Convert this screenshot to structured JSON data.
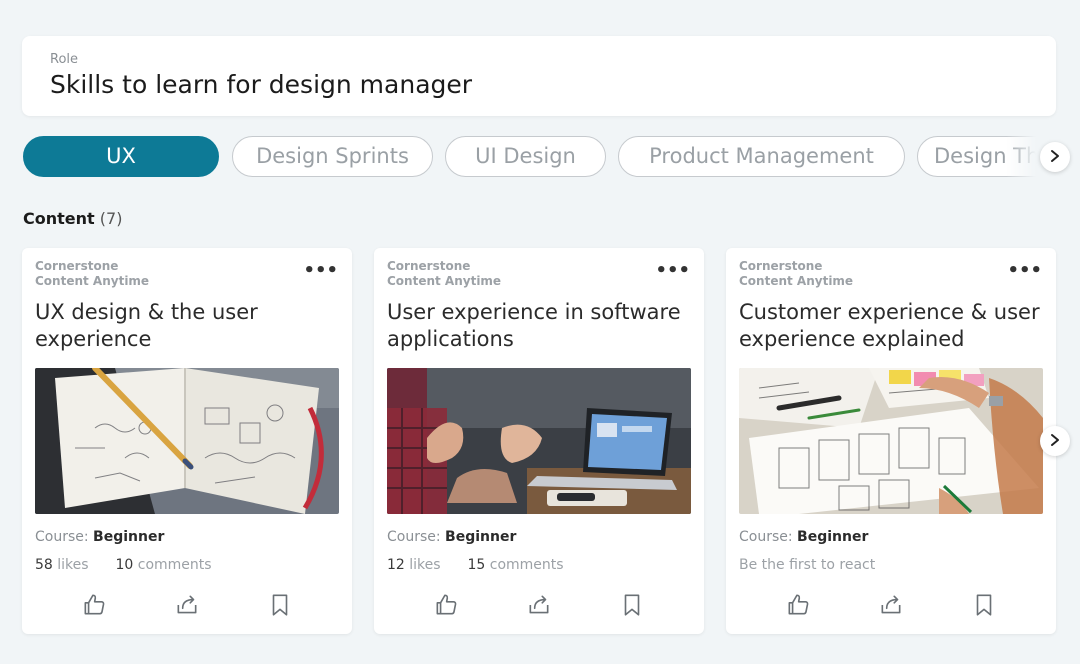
{
  "role": {
    "label": "Role",
    "value": "Skills to learn for design manager"
  },
  "chips": [
    {
      "label": "UX",
      "active": true
    },
    {
      "label": "Design Sprints",
      "active": false
    },
    {
      "label": "UI Design",
      "active": false
    },
    {
      "label": "Product Management",
      "active": false
    },
    {
      "label": "Design Thinking",
      "active": false
    }
  ],
  "content": {
    "title": "Content",
    "count": "(7)"
  },
  "cards": [
    {
      "provider_line1": "Cornerstone",
      "provider_line2": "Content Anytime",
      "title": "UX design & the user experience",
      "level_prefix": "Course:",
      "level": "Beginner",
      "likes_count": "58",
      "likes_label": "likes",
      "comments_count": "10",
      "comments_label": "comments",
      "image": "sketchbook-with-pencil"
    },
    {
      "provider_line1": "Cornerstone",
      "provider_line2": "Content Anytime",
      "title": "User experience in software applications",
      "level_prefix": "Course:",
      "level": "Beginner",
      "likes_count": "12",
      "likes_label": "likes",
      "comments_count": "15",
      "comments_label": "comments",
      "image": "people-at-laptop"
    },
    {
      "provider_line1": "Cornerstone",
      "provider_line2": "Content Anytime",
      "title": "Customer experience & user experience explained",
      "level_prefix": "Course:",
      "level": "Beginner",
      "react_text": "Be the first to react",
      "image": "wireframe-sketches"
    }
  ],
  "more_label": "•••",
  "colors": {
    "accent": "#0d7a96",
    "background": "#f1f5f7",
    "card": "#ffffff"
  },
  "icons": [
    "chevron-right-icon",
    "thumbs-up-icon",
    "share-icon",
    "bookmark-icon",
    "more-icon"
  ]
}
